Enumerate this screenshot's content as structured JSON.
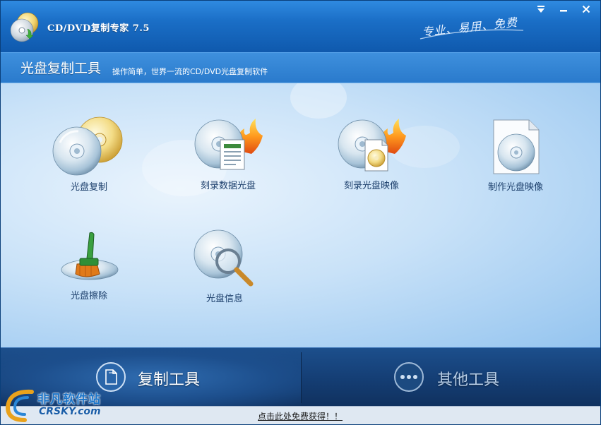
{
  "window": {
    "title": "CD/DVD复制专家 7.5",
    "slogan": "专业、易用、免费",
    "controls": [
      "▾",
      "▬",
      "✕"
    ]
  },
  "header": {
    "section_title": "光盘复制工具",
    "section_desc": "操作简单，世界一流的CD/DVD光盘复制软件"
  },
  "tools": [
    {
      "label": "光盘复制",
      "icon": "disc-copy-icon"
    },
    {
      "label": "刻录数据光盘",
      "icon": "burn-data-disc-icon"
    },
    {
      "label": "刻录光盘映像",
      "icon": "burn-image-icon"
    },
    {
      "label": "制作光盘映像",
      "icon": "make-image-icon"
    },
    {
      "label": "光盘擦除",
      "icon": "disc-erase-icon"
    },
    {
      "label": "光盘信息",
      "icon": "disc-info-icon"
    }
  ],
  "tabs": [
    {
      "label": "复制工具",
      "icon": "copy-tool-icon",
      "active": true
    },
    {
      "label": "其他工具",
      "icon": "more-tools-icon",
      "active": false
    }
  ],
  "footer": {
    "link_text": "点击此处免费获得！！"
  },
  "watermark": {
    "cn": "非凡软件站",
    "en": "CRSKY.com"
  },
  "colors": {
    "title_bar": "#1a6ec6",
    "content_bg": "#c9e2f8",
    "tab_bar": "#153f76",
    "label_text": "#1b3e6b"
  }
}
